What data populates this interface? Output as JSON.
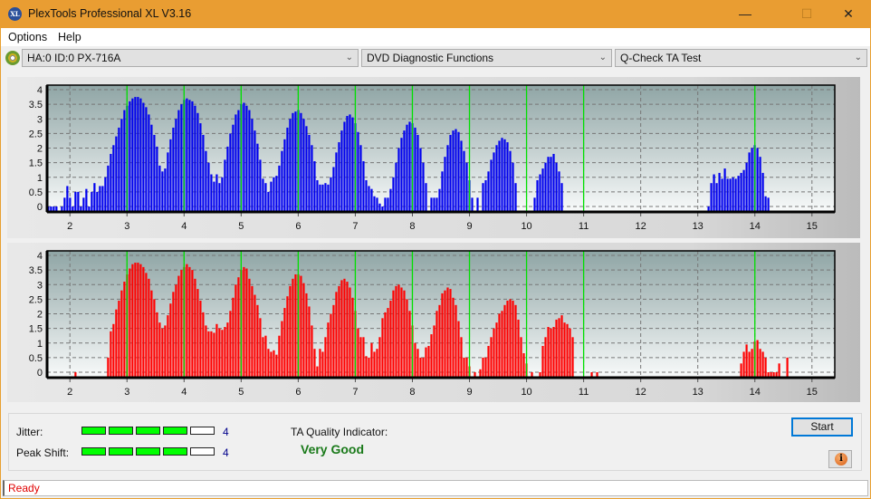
{
  "window": {
    "title": "PlexTools Professional XL V3.16",
    "logo_text": "XL",
    "controls": {
      "minimize": "—",
      "maximize": "☐",
      "close": "✕"
    }
  },
  "menu": {
    "items": [
      {
        "label": "Options"
      },
      {
        "label": "Help"
      }
    ]
  },
  "toolbar": {
    "drive": {
      "value": "HA:0 ID:0  PX-716A",
      "icon": "disc-icon"
    },
    "function": {
      "value": "DVD Diagnostic Functions"
    },
    "test": {
      "value": "Q-Check TA Test"
    },
    "chevron": "⌄"
  },
  "colors": {
    "top_bars": "#0000ee",
    "bottom_bars": "#ff0000",
    "marker": "#00e000",
    "accent": "#e99d32"
  },
  "chart_data": [
    {
      "type": "bar",
      "name": "top-chart",
      "ylim": [
        0,
        4
      ],
      "xlim": [
        1.6,
        15.4
      ],
      "yticks": [
        "0",
        "0.5",
        "1",
        "1.5",
        "2",
        "2.5",
        "3",
        "3.5",
        "4"
      ],
      "xticks": [
        "2",
        "3",
        "4",
        "5",
        "6",
        "7",
        "8",
        "9",
        "10",
        "11",
        "12",
        "13",
        "14",
        "15"
      ],
      "markers": [
        3,
        4,
        5,
        6,
        7,
        8,
        9,
        10,
        11,
        14
      ],
      "x_start": 1.62,
      "x_step": 0.0476,
      "values": [
        0,
        0,
        0,
        0,
        null,
        0,
        0.3,
        0.7,
        0.3,
        0,
        0.5,
        0.5,
        0,
        0.3,
        0.6,
        0,
        0.5,
        0.8,
        0.5,
        0.7,
        0.7,
        1.0,
        1.4,
        1.8,
        2.1,
        2.4,
        2.7,
        3.0,
        3.3,
        3.45,
        3.6,
        3.7,
        3.75,
        3.75,
        3.7,
        3.55,
        3.4,
        3.15,
        2.8,
        2.45,
        2.05,
        1.4,
        1.2,
        1.3,
        1.85,
        2.3,
        2.7,
        3.0,
        3.3,
        3.5,
        3.65,
        3.7,
        3.65,
        3.6,
        3.45,
        3.2,
        2.85,
        2.45,
        1.9,
        1.5,
        1.1,
        0.85,
        1.1,
        0.8,
        1.0,
        1.6,
        2.05,
        2.5,
        2.8,
        3.15,
        3.3,
        3.5,
        3.55,
        3.45,
        3.3,
        3.0,
        2.6,
        2.15,
        1.6,
        0.95,
        0.8,
        0.5,
        0.85,
        1.0,
        1.05,
        1.4,
        1.9,
        2.3,
        2.7,
        3.0,
        3.2,
        3.25,
        3.3,
        3.2,
        3.0,
        2.75,
        2.45,
        2.1,
        1.55,
        0.9,
        0.75,
        0.75,
        0.8,
        0.75,
        1.0,
        1.35,
        1.85,
        2.2,
        2.6,
        2.9,
        3.1,
        3.15,
        3.05,
        2.85,
        2.55,
        2.1,
        1.55,
        0.9,
        0.7,
        0.6,
        0.35,
        0.3,
        0.1,
        0.0,
        0.3,
        0.3,
        0.6,
        1.0,
        1.5,
        2.0,
        2.35,
        2.6,
        2.8,
        2.9,
        2.85,
        2.7,
        2.45,
        2.0,
        1.5,
        0.8,
        null,
        0.3,
        0.3,
        0.3,
        0.6,
        1.2,
        1.7,
        2.1,
        2.45,
        2.6,
        2.65,
        2.55,
        2.25,
        1.9,
        1.5,
        0.9,
        0.3,
        null,
        0.3,
        null,
        0.8,
        0.9,
        1.2,
        1.6,
        1.85,
        2.1,
        2.25,
        2.35,
        2.3,
        2.2,
        1.9,
        1.5,
        0.8,
        null,
        null,
        null,
        null,
        null,
        null,
        0.3,
        0.9,
        1.1,
        1.3,
        1.5,
        1.7,
        1.7,
        1.8,
        1.5,
        1.2,
        0.8,
        null,
        null,
        null,
        null,
        null,
        null,
        null,
        null,
        null,
        null,
        null,
        null,
        null,
        null,
        null,
        null,
        null,
        null,
        null,
        null,
        null,
        null,
        null,
        null,
        null,
        null,
        null,
        null,
        null,
        null,
        null,
        null,
        null,
        null,
        null,
        null,
        null,
        null,
        null,
        null,
        null,
        null,
        null,
        null,
        null,
        null,
        null,
        null,
        null,
        null,
        null,
        null,
        null,
        0.0,
        0.8,
        1.1,
        0.8,
        1.15,
        0.95,
        1.3,
        0.95,
        0.95,
        1.0,
        0.95,
        1.05,
        1.15,
        1.25,
        1.5,
        1.85,
        2.0,
        2.1,
        2.0,
        1.7,
        1.15,
        0.35,
        0.3
      ]
    },
    {
      "type": "bar",
      "name": "bottom-chart",
      "ylim": [
        0,
        4
      ],
      "xlim": [
        1.6,
        15.4
      ],
      "yticks": [
        "0",
        "0.5",
        "1",
        "1.5",
        "2",
        "2.5",
        "3",
        "3.5",
        "4"
      ],
      "xticks": [
        "2",
        "3",
        "4",
        "5",
        "6",
        "7",
        "8",
        "9",
        "10",
        "11",
        "12",
        "13",
        "14",
        "15"
      ],
      "markers": [
        3,
        4,
        5,
        6,
        7,
        8,
        9,
        10,
        11,
        14
      ],
      "x_start": 1.62,
      "x_step": 0.0476,
      "values": [
        null,
        null,
        null,
        null,
        null,
        null,
        null,
        null,
        null,
        null,
        0.0,
        null,
        null,
        null,
        null,
        null,
        null,
        null,
        null,
        null,
        null,
        null,
        0.5,
        1.4,
        1.65,
        2.15,
        2.45,
        2.8,
        3.1,
        3.35,
        3.55,
        3.7,
        3.75,
        3.75,
        3.7,
        3.6,
        3.4,
        3.2,
        2.8,
        2.5,
        2.05,
        1.7,
        1.5,
        1.6,
        1.95,
        2.35,
        2.75,
        3.0,
        3.3,
        3.5,
        3.6,
        3.7,
        3.6,
        3.5,
        3.2,
        2.85,
        2.45,
        2.05,
        1.6,
        1.4,
        1.4,
        1.35,
        1.65,
        1.5,
        1.45,
        1.55,
        1.7,
        2.1,
        2.55,
        3.0,
        3.25,
        3.5,
        3.6,
        3.55,
        3.2,
        2.95,
        2.65,
        2.3,
        1.85,
        1.2,
        1.25,
        0.8,
        0.7,
        0.75,
        0.6,
        1.25,
        1.75,
        2.2,
        2.6,
        2.95,
        3.2,
        3.35,
        3.35,
        3.3,
        3.05,
        2.7,
        2.25,
        1.6,
        0.8,
        0.2,
        0.8,
        0.7,
        1.2,
        1.7,
        2.0,
        2.3,
        2.75,
        2.95,
        3.15,
        3.2,
        3.1,
        2.9,
        2.55,
        2.1,
        1.5,
        1.2,
        1.2,
        0.55,
        0.5,
        1.0,
        0.7,
        0.8,
        1.2,
        1.85,
        2.05,
        2.2,
        2.45,
        2.8,
        2.95,
        3.0,
        2.9,
        2.8,
        2.5,
        2.1,
        1.6,
        1.0,
        0.8,
        0.5,
        0.5,
        0.85,
        0.9,
        1.3,
        1.6,
        2.1,
        2.3,
        2.7,
        2.8,
        2.9,
        2.85,
        2.55,
        2.3,
        1.75,
        1.2,
        0.5,
        0.5,
        0.2,
        null,
        0.0,
        null,
        0.1,
        0.5,
        0.5,
        0.9,
        1.2,
        1.5,
        1.7,
        2.0,
        2.1,
        2.3,
        2.45,
        2.5,
        2.45,
        2.3,
        1.8,
        1.2,
        0.65,
        0.3,
        null,
        0.0,
        null,
        null,
        0.0,
        0.9,
        1.2,
        1.55,
        1.5,
        1.55,
        1.8,
        1.85,
        1.95,
        1.7,
        1.65,
        1.5,
        1.2,
        null,
        null,
        null,
        null,
        null,
        null,
        0.0,
        null,
        0.0,
        null,
        null,
        null,
        null,
        null,
        null,
        null,
        null,
        null,
        null,
        null,
        null,
        null,
        null,
        null,
        null,
        null,
        null,
        null,
        null,
        null,
        null,
        null,
        null,
        null,
        null,
        null,
        null,
        null,
        null,
        null,
        null,
        null,
        null,
        null,
        null,
        null,
        null,
        null,
        null,
        null,
        null,
        null,
        null,
        null,
        null,
        null,
        null,
        null,
        null,
        null,
        null,
        0.3,
        0.7,
        0.95,
        0.7,
        0.8,
        1.05,
        1.1,
        0.8,
        0.7,
        0.5,
        0.0,
        0.0,
        0.0,
        0.0,
        0.3,
        null,
        null,
        0.5
      ]
    }
  ],
  "metrics": {
    "jitter": {
      "label": "Jitter:",
      "value": "4",
      "level": 4,
      "max": 5
    },
    "peak_shift": {
      "label": "Peak Shift:",
      "value": "4",
      "level": 4,
      "max": 5
    },
    "ta_quality": {
      "label": "TA Quality Indicator:",
      "value": "Very Good"
    }
  },
  "buttons": {
    "start": "Start",
    "info": "i"
  },
  "status": {
    "text": "Ready"
  }
}
